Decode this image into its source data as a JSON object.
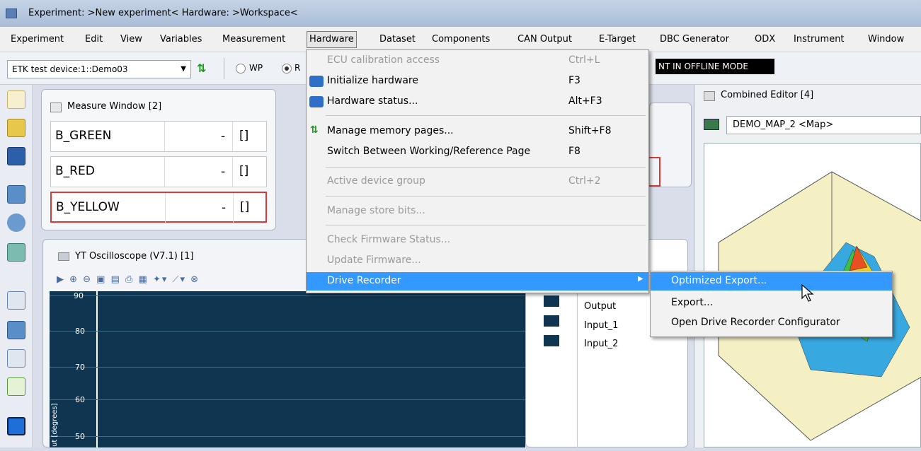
{
  "window": {
    "title": "Experiment: >New experiment< Hardware: >Workspace<"
  },
  "menubar": {
    "items": [
      "Experiment",
      "Edit",
      "View",
      "Variables",
      "Measurement",
      "Hardware",
      "Dataset",
      "Components",
      "CAN Output",
      "E-Target",
      "DBC Generator",
      "ODX",
      "Instrument",
      "Window"
    ]
  },
  "toolbar": {
    "device": "ETK test device:1::Demo03",
    "radio_wp": "WP",
    "radio_rp": "R",
    "offline_text": "NT IN OFFLINE MODE"
  },
  "measure_window": {
    "title": "Measure Window [2]",
    "rows": [
      {
        "name": "B_GREEN",
        "value": "-",
        "unit": "[]"
      },
      {
        "name": "B_RED",
        "value": "-",
        "unit": "[]"
      },
      {
        "name": "B_YELLOW",
        "value": "-",
        "unit": "[]"
      }
    ]
  },
  "oscilloscope": {
    "title": "YT Oscilloscope (V7.1) [1]",
    "ylabel": "ut [degrees]",
    "yticks": [
      "90",
      "80",
      "70",
      "60",
      "50"
    ],
    "legend": [
      "Output",
      "Input_1",
      "Input_2"
    ]
  },
  "combined_editor": {
    "title": "Combined Editor [4]",
    "selected": "DEMO_MAP_2 <Map>"
  },
  "hardware_menu": {
    "items": [
      {
        "label": "ECU calibration access",
        "shortcut": "Ctrl+L",
        "disabled": true
      },
      {
        "label": "Initialize hardware",
        "shortcut": "F3",
        "disabled": false
      },
      {
        "label": "Hardware status...",
        "shortcut": "Alt+F3",
        "disabled": false
      },
      {
        "label": "Manage memory pages...",
        "shortcut": "Shift+F8",
        "disabled": false
      },
      {
        "label": "Switch Between Working/Reference Page",
        "shortcut": "F8",
        "disabled": false
      },
      {
        "label": "Active device group",
        "shortcut": "Ctrl+2",
        "disabled": true
      },
      {
        "label": "Manage store bits...",
        "shortcut": "",
        "disabled": true
      },
      {
        "label": "Check Firmware Status...",
        "shortcut": "",
        "disabled": true
      },
      {
        "label": "Update Firmware...",
        "shortcut": "",
        "disabled": true
      },
      {
        "label": "Drive Recorder",
        "shortcut": "",
        "disabled": false
      }
    ]
  },
  "drive_recorder_submenu": {
    "items": [
      "Optimized Export...",
      "Export...",
      "Open Drive Recorder Configurator"
    ]
  },
  "colors": {
    "highlight": "#3399ff",
    "plot_bg": "#0f3550"
  }
}
